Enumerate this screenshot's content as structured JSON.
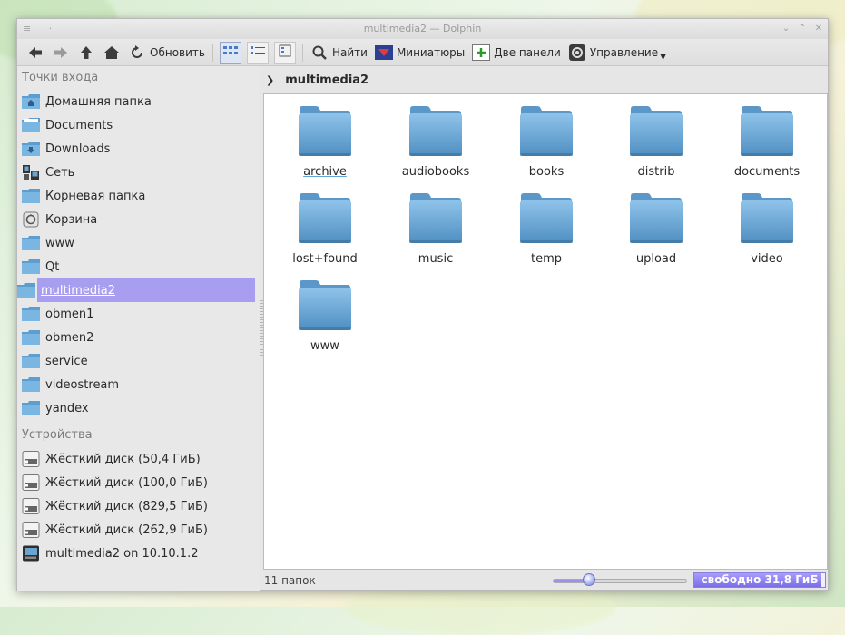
{
  "window": {
    "title": "multimedia2 — Dolphin"
  },
  "toolbar": {
    "refresh_label": "Обновить",
    "find_label": "Найти",
    "preview_label": "Миниатюры",
    "split_label": "Две панели",
    "control_label": "Управление"
  },
  "sidebar": {
    "places_title": "Точки входа",
    "places": [
      {
        "label": "Домашняя папка",
        "icon": "home-folder-icon"
      },
      {
        "label": "Documents",
        "icon": "documents-folder-icon"
      },
      {
        "label": "Downloads",
        "icon": "downloads-folder-icon"
      },
      {
        "label": "Сеть",
        "icon": "network-icon"
      },
      {
        "label": "Корневая папка",
        "icon": "folder-icon"
      },
      {
        "label": "Корзина",
        "icon": "trash-icon"
      },
      {
        "label": "www",
        "icon": "folder-icon"
      },
      {
        "label": "Qt",
        "icon": "folder-icon"
      },
      {
        "label": "multimedia2",
        "icon": "folder-icon",
        "selected": true
      },
      {
        "label": "obmen1",
        "icon": "folder-icon"
      },
      {
        "label": "obmen2",
        "icon": "folder-icon"
      },
      {
        "label": "service",
        "icon": "folder-icon"
      },
      {
        "label": "videostream",
        "icon": "folder-icon"
      },
      {
        "label": "yandex",
        "icon": "folder-icon"
      }
    ],
    "devices_title": "Устройства",
    "devices": [
      {
        "label": "Жёсткий диск (50,4 ГиБ)",
        "icon": "hard-disk-icon"
      },
      {
        "label": "Жёсткий диск (100,0 ГиБ)",
        "icon": "hard-disk-icon"
      },
      {
        "label": "Жёсткий диск (829,5 ГиБ)",
        "icon": "hard-disk-icon"
      },
      {
        "label": "Жёсткий диск (262,9 ГиБ)",
        "icon": "hard-disk-icon"
      },
      {
        "label": "multimedia2 on 10.10.1.2",
        "icon": "network-drive-icon"
      }
    ]
  },
  "breadcrumb": {
    "current": "multimedia2"
  },
  "folders": [
    {
      "name": "archive"
    },
    {
      "name": "audiobooks"
    },
    {
      "name": "books"
    },
    {
      "name": "distrib"
    },
    {
      "name": "documents"
    },
    {
      "name": "lost+found"
    },
    {
      "name": "music"
    },
    {
      "name": "temp"
    },
    {
      "name": "upload"
    },
    {
      "name": "video"
    },
    {
      "name": "www"
    }
  ],
  "status": {
    "count_text": "11 папок",
    "free_space_text": "свободно 31,8 ГиБ",
    "zoom_fraction": 0.27,
    "used_fraction": 0.97
  },
  "colors": {
    "selection": "#a79ef0",
    "folder": "#6aa5d2",
    "accent": "#7b6ee6"
  }
}
